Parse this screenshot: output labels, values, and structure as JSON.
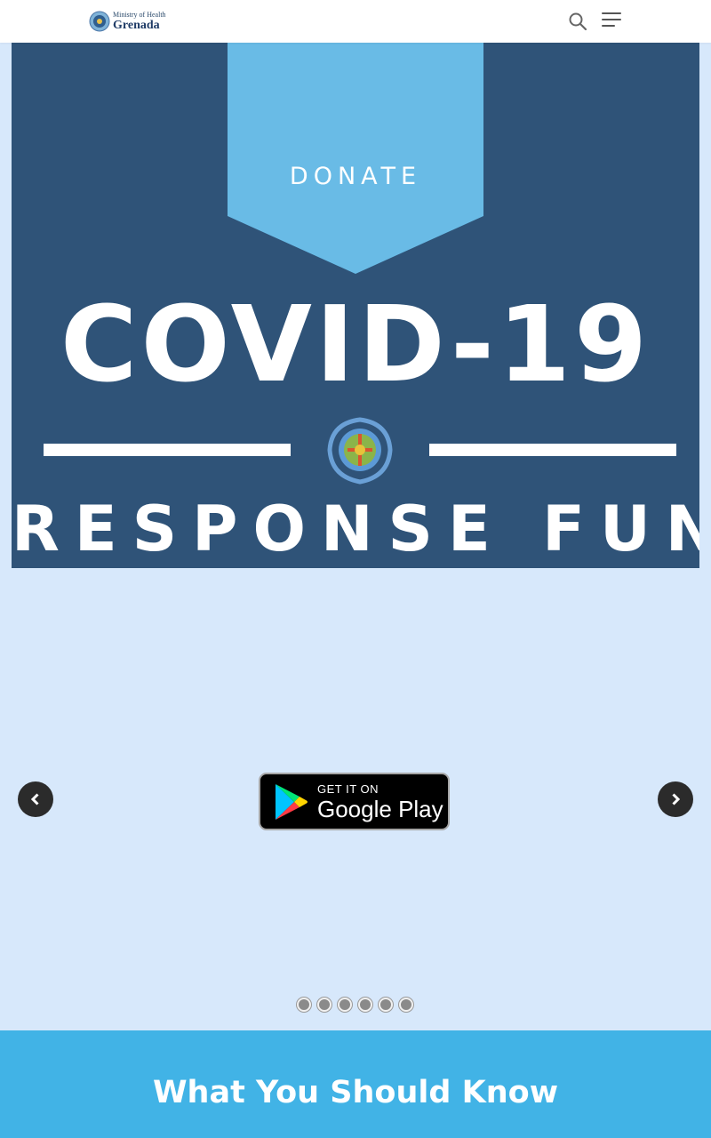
{
  "header": {
    "logo_top": "Ministry of Health",
    "logo_bottom": "Grenada",
    "search_icon": "search-icon",
    "menu_icon": "hamburger-menu-icon"
  },
  "slider": {
    "slides_count": 6,
    "active_slide": 1,
    "banner": {
      "donate": "DONATE",
      "headline": "COVID-19",
      "subheadline": "RESPONSE FUND"
    },
    "app_badge": {
      "top": "GET IT ON",
      "bottom": "Google Play"
    },
    "prev_icon": "chevron-left-icon",
    "next_icon": "chevron-right-icon"
  },
  "info": {
    "title": "What You Should Know"
  },
  "colors": {
    "banner_bg": "#2f5378",
    "ribbon": "#69bbe6",
    "slider_bg": "#d7e8fb",
    "info_bg": "#41b3e6"
  }
}
